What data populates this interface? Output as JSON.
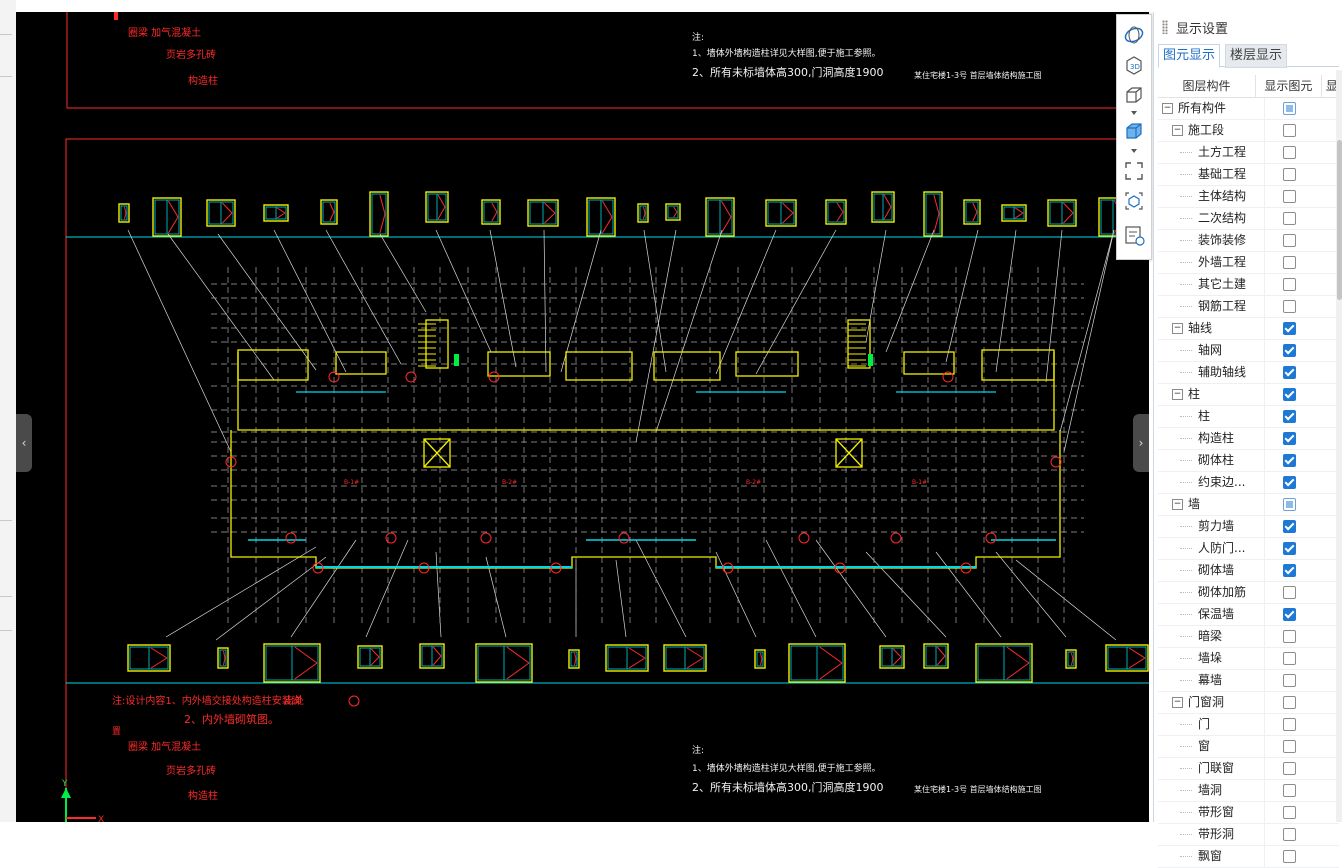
{
  "drawing": {
    "top_notes": [
      "圈梁 加气混凝土",
      "页岩多孔砖",
      "构造柱"
    ],
    "top_remark_title": "注:",
    "top_remark_line1": "1、墙体外墙构造柱详见大样图,便于施工参照。",
    "top_remark_line2": "2、所有未标墙体高300,门洞高度1900",
    "top_title": "某住宅楼1-3号 首层墙体结构施工图",
    "bottom_notes_line1": "注:设计内容1、内外墙交接处构造柱安装详",
    "bottom_notes_tail": "出处",
    "bottom_notes_line2": "2、内外墙砌筑图。",
    "bottom_notes_small": "置",
    "bottom_legend": [
      "圈梁 加气混凝土",
      "页岩多孔砖",
      "构造柱"
    ],
    "bottom_remark_title": "注:",
    "bottom_remark_line1": "1、墙体外墙构造柱详见大样图,便于施工参照。",
    "bottom_remark_line2": "2、所有未标墙体高300,门洞高度1900",
    "bottom_title": "某住宅楼1-3号 首层墙体结构施工图",
    "room_tags": [
      "B-1#",
      "B-2#",
      "B-2#",
      "B-1#"
    ]
  },
  "toolbar": {
    "buttons": [
      "dynamic-observe-icon",
      "3d-view-icon",
      "top-view-icon",
      "iso-cube-icon",
      "full-screen-icon",
      "component-view-icon",
      "display-settings-icon"
    ]
  },
  "panel": {
    "title": "显示设置",
    "tabs": [
      "图元显示",
      "楼层显示"
    ],
    "columns": [
      "图层构件",
      "显示图元",
      "显"
    ],
    "rows": [
      {
        "label": "所有构件",
        "level": 0,
        "toggle": "−",
        "state": "partial"
      },
      {
        "label": "施工段",
        "level": 1,
        "toggle": "−",
        "state": "unchecked"
      },
      {
        "label": "土方工程",
        "level": 2,
        "toggle": "",
        "state": "unchecked"
      },
      {
        "label": "基础工程",
        "level": 2,
        "toggle": "",
        "state": "unchecked"
      },
      {
        "label": "主体结构",
        "level": 2,
        "toggle": "",
        "state": "unchecked"
      },
      {
        "label": "二次结构",
        "level": 2,
        "toggle": "",
        "state": "unchecked"
      },
      {
        "label": "装饰装修",
        "level": 2,
        "toggle": "",
        "state": "unchecked"
      },
      {
        "label": "外墙工程",
        "level": 2,
        "toggle": "",
        "state": "unchecked"
      },
      {
        "label": "其它土建",
        "level": 2,
        "toggle": "",
        "state": "unchecked"
      },
      {
        "label": "钢筋工程",
        "level": 2,
        "toggle": "",
        "state": "unchecked"
      },
      {
        "label": "轴线",
        "level": 1,
        "toggle": "−",
        "state": "checked"
      },
      {
        "label": "轴网",
        "level": 2,
        "toggle": "",
        "state": "checked"
      },
      {
        "label": "辅助轴线",
        "level": 2,
        "toggle": "",
        "state": "checked"
      },
      {
        "label": "柱",
        "level": 1,
        "toggle": "−",
        "state": "checked"
      },
      {
        "label": "柱",
        "level": 2,
        "toggle": "",
        "state": "checked"
      },
      {
        "label": "构造柱",
        "level": 2,
        "toggle": "",
        "state": "checked"
      },
      {
        "label": "砌体柱",
        "level": 2,
        "toggle": "",
        "state": "checked"
      },
      {
        "label": "约束边...",
        "level": 2,
        "toggle": "",
        "state": "checked"
      },
      {
        "label": "墙",
        "level": 1,
        "toggle": "−",
        "state": "partial"
      },
      {
        "label": "剪力墙",
        "level": 2,
        "toggle": "",
        "state": "checked"
      },
      {
        "label": "人防门...",
        "level": 2,
        "toggle": "",
        "state": "checked"
      },
      {
        "label": "砌体墙",
        "level": 2,
        "toggle": "",
        "state": "checked"
      },
      {
        "label": "砌体加筋",
        "level": 2,
        "toggle": "",
        "state": "unchecked"
      },
      {
        "label": "保温墙",
        "level": 2,
        "toggle": "",
        "state": "checked"
      },
      {
        "label": "暗梁",
        "level": 2,
        "toggle": "",
        "state": "unchecked"
      },
      {
        "label": "墙垛",
        "level": 2,
        "toggle": "",
        "state": "unchecked"
      },
      {
        "label": "幕墙",
        "level": 2,
        "toggle": "",
        "state": "unchecked"
      },
      {
        "label": "门窗洞",
        "level": 1,
        "toggle": "−",
        "state": "unchecked"
      },
      {
        "label": "门",
        "level": 2,
        "toggle": "",
        "state": "unchecked"
      },
      {
        "label": "窗",
        "level": 2,
        "toggle": "",
        "state": "unchecked"
      },
      {
        "label": "门联窗",
        "level": 2,
        "toggle": "",
        "state": "unchecked"
      },
      {
        "label": "墙洞",
        "level": 2,
        "toggle": "",
        "state": "unchecked"
      },
      {
        "label": "带形窗",
        "level": 2,
        "toggle": "",
        "state": "unchecked"
      },
      {
        "label": "带形洞",
        "level": 2,
        "toggle": "",
        "state": "unchecked"
      },
      {
        "label": "飘窗",
        "level": 2,
        "toggle": "",
        "state": "unchecked"
      }
    ]
  },
  "colors": {
    "accent": "#1d78d6",
    "cad_bg": "#000000",
    "cad_red": "#ff2a2a",
    "cad_cyan": "#00d8e8",
    "cad_yellow": "#f4f000"
  }
}
